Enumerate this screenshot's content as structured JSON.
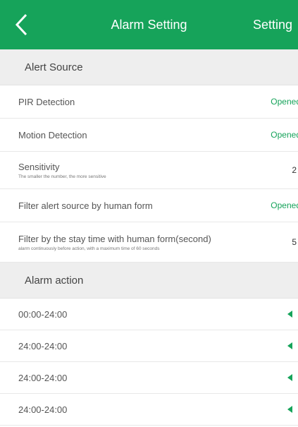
{
  "header": {
    "title": "Alarm Setting",
    "action": "Setting",
    "back_icon": "chevron-left-icon",
    "background": "#16a35a"
  },
  "alert_source": {
    "section_title": "Alert Source",
    "items": [
      {
        "label": "PIR Detection",
        "value": "Opened"
      },
      {
        "label": "Motion Detection",
        "value": "Opened"
      },
      {
        "label": "Sensitivity",
        "sub": "The smaller the number, the more sensitive",
        "value": "2"
      },
      {
        "label": "Filter alert source by human form",
        "value": "Opened"
      },
      {
        "label": "Filter by the stay time with human form(second)",
        "sub": "alarm continuously before action, with a maximum time of 60 seconds",
        "value": "5"
      }
    ]
  },
  "alarm_action": {
    "section_title": "Alarm action",
    "items": [
      {
        "label": "00:00-24:00",
        "icon": "speaker-icon"
      },
      {
        "label": "24:00-24:00",
        "icon": "speaker-icon"
      },
      {
        "label": "24:00-24:00",
        "icon": "speaker-icon"
      },
      {
        "label": "24:00-24:00",
        "icon": "speaker-icon"
      }
    ]
  },
  "colors": {
    "accent": "#16a35a",
    "section_bg": "#eeeeee"
  }
}
